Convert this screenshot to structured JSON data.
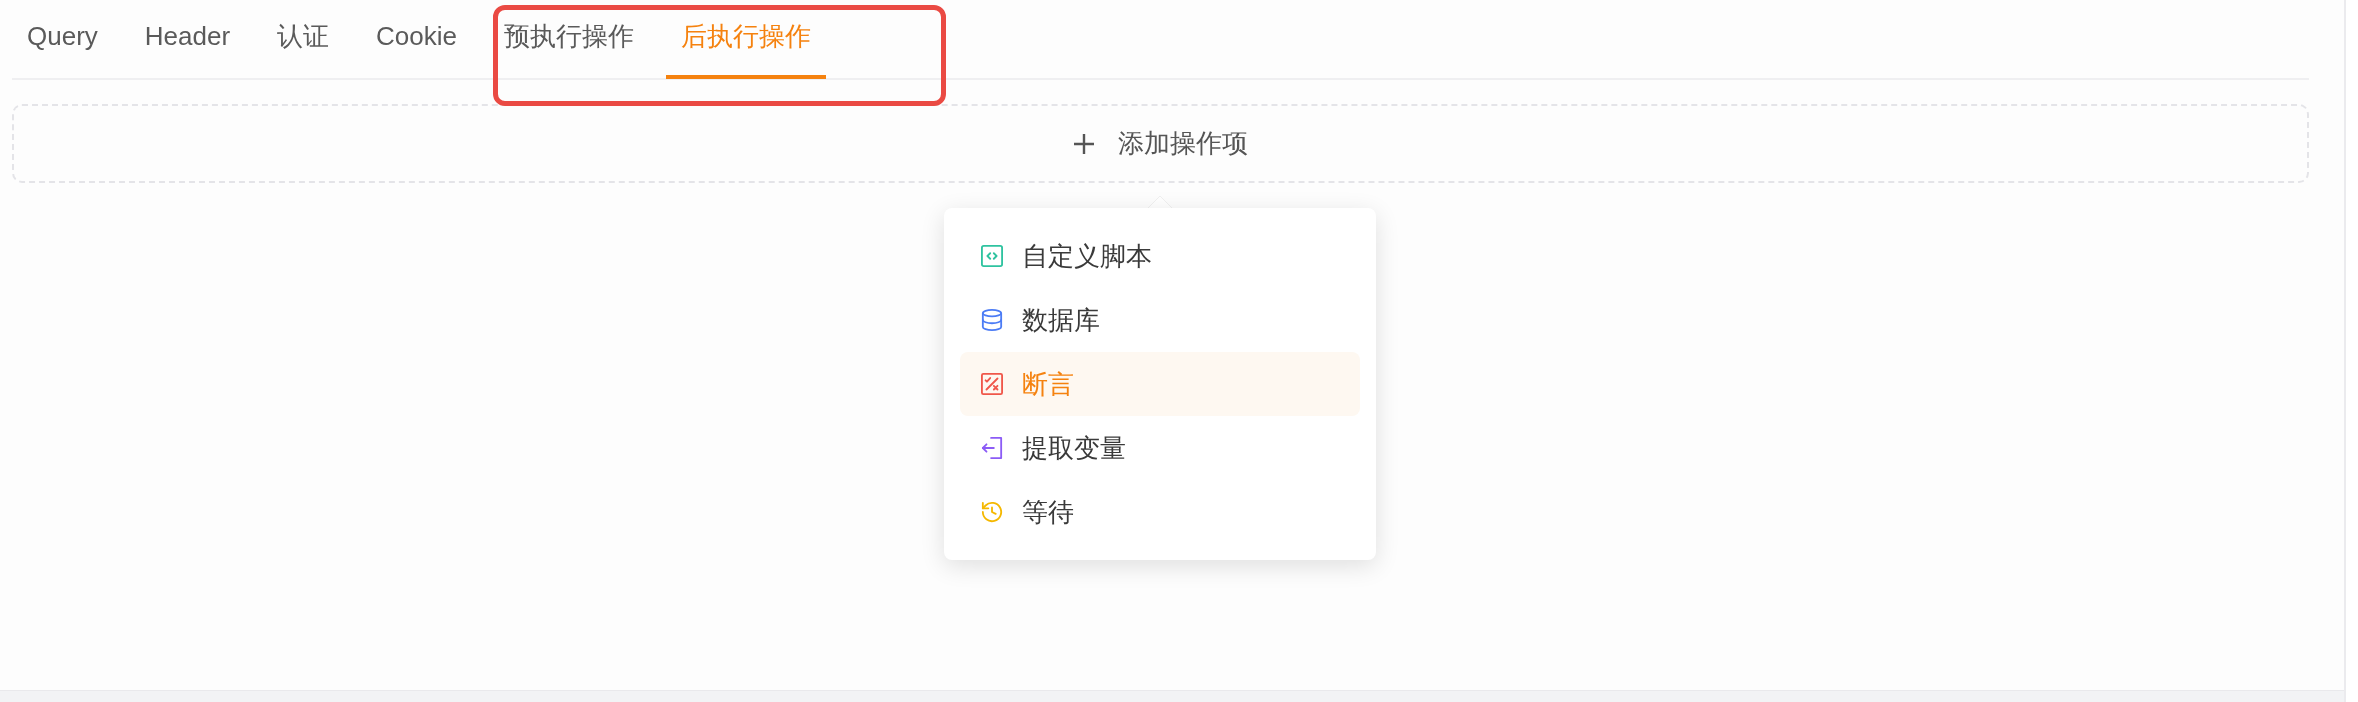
{
  "tabs": [
    {
      "label": "Query",
      "selected": false
    },
    {
      "label": "Header",
      "selected": false
    },
    {
      "label": "认证",
      "selected": false
    },
    {
      "label": "Cookie",
      "selected": false
    },
    {
      "label": "预执行操作",
      "selected": false
    },
    {
      "label": "后执行操作",
      "selected": true
    }
  ],
  "add_button": {
    "label": "添加操作项"
  },
  "menu": {
    "items": [
      {
        "kind": "script",
        "label": "自定义脚本",
        "color": "#2fc3a0",
        "selected": false
      },
      {
        "kind": "database",
        "label": "数据库",
        "color": "#4c7cf5",
        "selected": false
      },
      {
        "kind": "assertion",
        "label": "断言",
        "color": "#f0574a",
        "selected": true
      },
      {
        "kind": "extract",
        "label": "提取变量",
        "color": "#8c5cf6",
        "selected": false
      },
      {
        "kind": "wait",
        "label": "等待",
        "color": "#f5b800",
        "selected": false
      }
    ]
  }
}
